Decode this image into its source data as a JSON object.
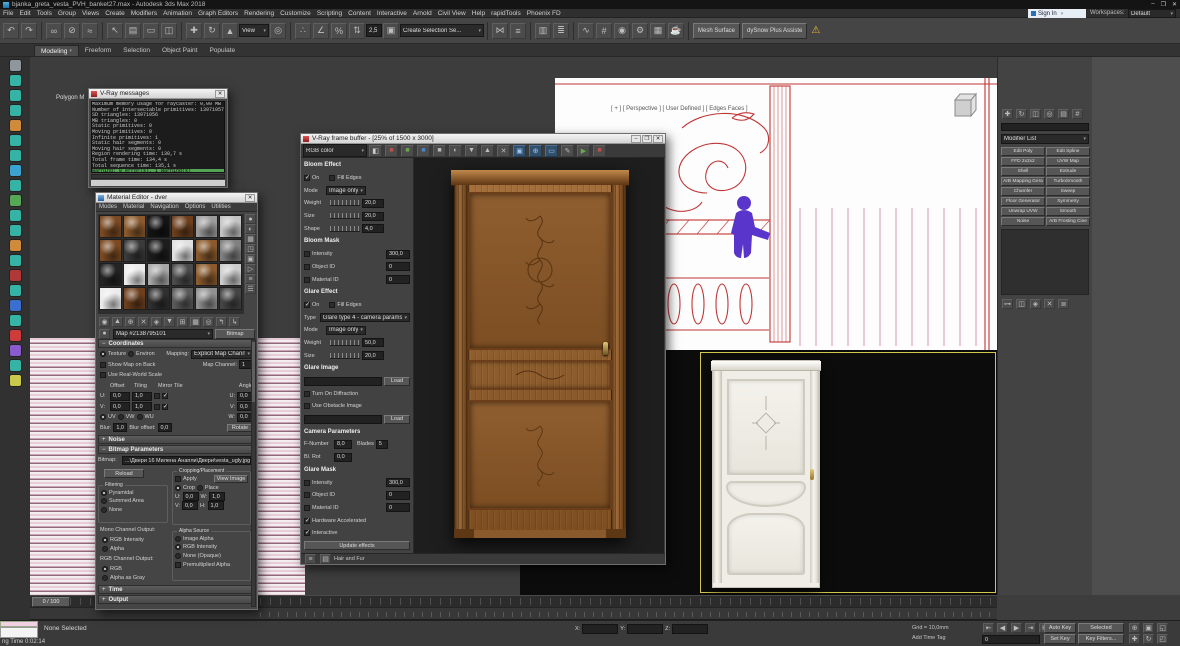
{
  "titlebar": {
    "title": "bjanka_greta_vesta_PVH_banket27.max - Autodesk 3ds Max 2018"
  },
  "window_buttons": {
    "minimize": "–",
    "maximize": "❐",
    "close": "✕"
  },
  "menus": [
    "File",
    "Edit",
    "Tools",
    "Group",
    "Views",
    "Create",
    "Modifiers",
    "Animation",
    "Graph Editors",
    "Rendering",
    "Customize",
    "Scripting",
    "Content",
    "Interactive",
    "Arnold",
    "Civil View",
    "Help",
    "rapidTools",
    "Phoenix FD"
  ],
  "topright": {
    "sign_in": "Sign In",
    "workspaces_label": "Workspaces:",
    "workspace_value": "Default"
  },
  "toolbar": {
    "items": [
      {
        "t": "i",
        "n": "undo-icon",
        "g": "↶"
      },
      {
        "t": "i",
        "n": "redo-icon",
        "g": "↷"
      },
      {
        "t": "s"
      },
      {
        "t": "i",
        "n": "select-and-link-icon",
        "g": "∞"
      },
      {
        "t": "i",
        "n": "unlink-selection-icon",
        "g": "⊘"
      },
      {
        "t": "i",
        "n": "bind-to-space-warp-icon",
        "g": "≈"
      },
      {
        "t": "s"
      },
      {
        "t": "i",
        "n": "select-object-icon",
        "g": "↖"
      },
      {
        "t": "i",
        "n": "select-by-name-icon",
        "g": "▤"
      },
      {
        "t": "i",
        "n": "rectangular-selection-region-icon",
        "g": "▭"
      },
      {
        "t": "i",
        "n": "window-crossing-icon",
        "g": "◫"
      },
      {
        "t": "s"
      },
      {
        "t": "i",
        "n": "select-and-move-icon",
        "g": "✚"
      },
      {
        "t": "i",
        "n": "select-and-rotate-icon",
        "g": "↻"
      },
      {
        "t": "i",
        "n": "select-and-scale-icon",
        "g": "▲"
      },
      {
        "t": "dd",
        "n": "reference-coordinate-dropdown",
        "v": "View",
        "w": 30
      },
      {
        "t": "i",
        "n": "use-pivot-point-icon",
        "g": "◎"
      },
      {
        "t": "s"
      },
      {
        "t": "i",
        "n": "snap-toggle-icon",
        "g": "∴"
      },
      {
        "t": "i",
        "n": "angle-snap-icon",
        "g": "∠"
      },
      {
        "t": "i",
        "n": "percent-snap-icon",
        "g": "%"
      },
      {
        "t": "i",
        "n": "spinner-snap-icon",
        "g": "⇅"
      },
      {
        "t": "f",
        "n": "snap-value-field",
        "v": "2,5",
        "w": 16
      },
      {
        "t": "i",
        "n": "edit-named-selection-sets-icon",
        "g": "▣"
      },
      {
        "t": "dd",
        "n": "named-selection-set-dropdown",
        "v": "Create Selection Se...",
        "w": 84
      },
      {
        "t": "s"
      },
      {
        "t": "i",
        "n": "mirror-icon",
        "g": "⋈"
      },
      {
        "t": "i",
        "n": "align-icon",
        "g": "≡"
      },
      {
        "t": "s"
      },
      {
        "t": "i",
        "n": "toggle-scene-explorer-icon",
        "g": "▥"
      },
      {
        "t": "i",
        "n": "toggle-layer-explorer-icon",
        "g": "≣"
      },
      {
        "t": "s"
      },
      {
        "t": "i",
        "n": "curve-editor-icon",
        "g": "∿"
      },
      {
        "t": "i",
        "n": "schematic-view-icon",
        "g": "#"
      },
      {
        "t": "i",
        "n": "material-editor-icon",
        "g": "◉"
      },
      {
        "t": "i",
        "n": "render-setup-icon",
        "g": "⚙"
      },
      {
        "t": "i",
        "n": "rendered-frame-window-icon",
        "g": "▦"
      },
      {
        "t": "i",
        "n": "render-production-icon",
        "g": "☕"
      },
      {
        "t": "s"
      },
      {
        "t": "lb",
        "n": "mesh-surface-button",
        "v": "Mesh Surface"
      },
      {
        "t": "lb",
        "n": "dysnow-plus-button",
        "v": "dySnow Plus Assiste"
      },
      {
        "t": "w",
        "n": "plugin-warning-icon",
        "g": "⚠"
      }
    ]
  },
  "ribbon_tabs": [
    "Modeling",
    "Freeform",
    "Selection",
    "Object Paint",
    "Populate"
  ],
  "left_toolbar": [
    "#8f969c",
    "#35b3a4",
    "#35b3a4",
    "#35b3a4",
    "#cf8a3a",
    "#35b3a4",
    "#35b3a4",
    "#3aa3cf",
    "#35b3a4",
    "#56a756",
    "#35b3a4",
    "#35b3a4",
    "#cf8a3a",
    "#35b3a4",
    "#b23737",
    "#35b3a4",
    "#3a6ecf",
    "#35b3a4",
    "#cf3a3a",
    "#8a5acf",
    "#35b3a4",
    "#c8c84a"
  ],
  "viewport": {
    "label": "[ + ] [ Perspective ] [ User Defined ] [ Edges Faces ]",
    "overlay": "Polygon M",
    "timeline_range": "0 / 100"
  },
  "vray_messages": {
    "title": "V-Ray messages",
    "lines": [
      "Maximum memory usage for raycaster: 0,00 MB",
      "Number of intersectable primitives: 13971057",
      "SD triangles: 13971056",
      "MB triangles: 0",
      "Static primitives: 0",
      "Moving primitives: 0",
      "Infinite primitives: 1",
      "Static hair segments: 0",
      "Moving hair segments: 0",
      "Region rendering time: 130,7 s",
      "Total frame time: 134,4 s",
      "Total sequence time: 135,1 s"
    ],
    "warning": "warning: 0 error(s), 1 warning(s)"
  },
  "material_editor": {
    "title": "Material Editor - dver",
    "menus": [
      "Modes",
      "Material",
      "Navigation",
      "Options",
      "Utilities"
    ],
    "swatches": [
      "#7b4a22",
      "#8a5a2c",
      "#141414",
      "#6d3f1d",
      "#9c9c9c",
      "#c2c2c2",
      "#7b4a22",
      "#3a3a3a",
      "#1d1d1d",
      "#e0e0e0",
      "#8a5a2c",
      "#808080",
      "#242424",
      "#ececec",
      "#a8a8a8",
      "#4c4c4c",
      "#8a5a2c",
      "#cccccc",
      "#ececec",
      "#6d3f1d",
      "#303030",
      "#5a5a5a",
      "#909090",
      "#454545"
    ],
    "side_icons": [
      {
        "n": "sample-type-icon",
        "g": "●"
      },
      {
        "n": "backlight-icon",
        "g": "◐"
      },
      {
        "n": "background-icon",
        "g": "▦"
      },
      {
        "n": "sample-uv-tiling-icon",
        "g": "◳"
      },
      {
        "n": "video-color-check-icon",
        "g": "▣"
      },
      {
        "n": "make-preview-icon",
        "g": "▷"
      },
      {
        "n": "options-icon",
        "g": "≡"
      },
      {
        "n": "select-by-material-icon",
        "g": "☰"
      }
    ],
    "toolbar_icons": [
      {
        "n": "get-material-icon",
        "g": "◉"
      },
      {
        "n": "put-material-to-scene-icon",
        "g": "▲"
      },
      {
        "n": "assign-material-to-selection-icon",
        "g": "⊕"
      },
      {
        "n": "reset-map-icon",
        "g": "✕"
      },
      {
        "n": "make-unique-icon",
        "g": "◈"
      },
      {
        "n": "put-to-library-icon",
        "g": "▼"
      },
      {
        "n": "material-id-channel-icon",
        "g": "⊞"
      },
      {
        "n": "show-map-in-viewport-icon",
        "g": "▦"
      },
      {
        "n": "show-end-result-icon",
        "g": "◎"
      },
      {
        "n": "go-to-parent-icon",
        "g": "↰"
      },
      {
        "n": "go-forward-sibling-icon",
        "g": "↳"
      }
    ],
    "name_dropdown": "Map #2138795101",
    "type_button": "Bitmap",
    "coordinates": {
      "header": "Coordinates",
      "texture": "Texture",
      "environ": "Environ",
      "mapping": "Mapping:",
      "mapping_value": "Explicit Map Channel",
      "show_map_on_back": "Show Map on Back",
      "map_channel": "Map Channel:",
      "map_channel_value": "1",
      "use_real_world": "Use Real-World Scale",
      "col_offset": "Offset",
      "col_tiling": "Tiling",
      "col_mirror": "Mirror",
      "col_tile": "Tile",
      "col_angle": "Angle",
      "u": "U:",
      "v": "V:",
      "w": "W:",
      "u_offset": "0,0",
      "u_tiling": "1,0",
      "v_offset": "0,0",
      "v_tiling": "1,0",
      "angle_u": "0,0",
      "angle_v": "0,0",
      "angle_w": "0,0",
      "uv": "UV",
      "vw": "VW",
      "wu": "WU",
      "blur": "Blur:",
      "blur_value": "1,0",
      "blur_offset": "Blur offset:",
      "blur_offset_value": "0,0",
      "rotate": "Rotate"
    },
    "noise_header": "Noise",
    "bp": {
      "header": "Bitmap Parameters",
      "bitmap_label": "Bitmap:",
      "path": "...\\Двери 16 Милена Анапли\\Двери\\vesta_ugly.jpg",
      "reload": "Reload",
      "cropping_group": "Cropping/Placement",
      "apply": "Apply",
      "view_image": "View Image",
      "crop": "Crop",
      "place": "Place",
      "u": "U:",
      "u_value": "0,0",
      "w": "W:",
      "w_value": "1,0",
      "v": "V:",
      "v_value": "0,0",
      "h": "H:",
      "h_value": "1,0",
      "filtering_group": "Filtering",
      "pyramidal": "Pyramidal",
      "summed_area": "Summed Area",
      "none": "None",
      "mono_label": "Mono Channel Output:",
      "rgb_intensity": "RGB Intensity",
      "alpha": "Alpha",
      "rgb_label": "RGB Channel Output:",
      "rgb": "RGB",
      "alpha_as_gray": "Alpha as Gray",
      "alpha_group": "Alpha Source",
      "image_alpha": "Image Alpha",
      "rgb_intensity2": "RGB Intensity",
      "none_opaque": "None (Opaque)",
      "premultiplied": "Premultiplied Alpha"
    },
    "time_header": "Time",
    "output_header": "Output"
  },
  "vfb": {
    "title": "V-Ray frame buffer - [25% of 1500 x 3000]",
    "channel": "RGB color",
    "toolbar_icons": [
      {
        "n": "show-rgb-icon",
        "g": "◧",
        "c": "#cccccc"
      },
      {
        "n": "red-channel-icon",
        "g": "■",
        "c": "#c0504d"
      },
      {
        "n": "green-channel-icon",
        "g": "■",
        "c": "#6aa84f"
      },
      {
        "n": "blue-channel-icon",
        "g": "■",
        "c": "#4a86c8"
      },
      {
        "n": "alpha-channel-icon",
        "g": "■",
        "c": "#bbbbbb"
      },
      {
        "n": "monochrome-icon",
        "g": "◐",
        "c": "#bbbbbb"
      },
      {
        "n": "save-image-icon",
        "g": "▼",
        "c": "#bbbbbb"
      },
      {
        "n": "load-image-icon",
        "g": "▲",
        "c": "#bbbbbb"
      },
      {
        "n": "clear-image-icon",
        "g": "✕",
        "c": "#bbbbbb"
      },
      {
        "n": "duplicate-to-host-icon",
        "g": "▣",
        "c": "#9fc4ea",
        "on": true
      },
      {
        "n": "track-mouse-icon",
        "g": "⊕",
        "c": "#9fc4ea",
        "on": true
      },
      {
        "n": "region-render-icon",
        "g": "▭",
        "c": "#9fc4ea",
        "on": true
      },
      {
        "n": "image-stamp-icon",
        "g": "✎",
        "c": "#bbbbbb"
      },
      {
        "n": "start-interactive-render-icon",
        "g": "▶",
        "c": "#6aa84f"
      },
      {
        "n": "stop-render-icon",
        "g": "■",
        "c": "#c0504d"
      }
    ],
    "rows": [
      {
        "t": "h",
        "x": "Bloom Effect"
      },
      {
        "t": "cc",
        "a": "On",
        "ao": 1,
        "b": "Fill Edges",
        "bo": 0
      },
      {
        "t": "dd",
        "l": "Mode",
        "v": "Image only"
      },
      {
        "t": "sl",
        "l": "Weight",
        "v": "20,0"
      },
      {
        "t": "sl",
        "l": "Size",
        "v": "20,0"
      },
      {
        "t": "sl",
        "l": "Shape",
        "v": "4,0"
      },
      {
        "t": "h2",
        "x": "Bloom Mask"
      },
      {
        "t": "cf",
        "l": "Intensity",
        "v": "300,0",
        "o": 0
      },
      {
        "t": "cf",
        "l": "Object ID",
        "v": "0",
        "o": 0
      },
      {
        "t": "cf",
        "l": "Material ID",
        "v": "0",
        "o": 0
      },
      {
        "t": "h",
        "x": "Glare Effect"
      },
      {
        "t": "cc",
        "a": "On",
        "ao": 1,
        "b": "Fill Edges",
        "bo": 0
      },
      {
        "t": "dd",
        "l": "Type",
        "v": "Glare type 4 - camera params"
      },
      {
        "t": "dd",
        "l": "Mode",
        "v": "Image only"
      },
      {
        "t": "sl",
        "l": "Weight",
        "v": "50,0"
      },
      {
        "t": "sl",
        "l": "Size",
        "v": "20,0"
      },
      {
        "t": "h2",
        "x": "Glare Image"
      },
      {
        "t": "ld",
        "btn": "Load"
      },
      {
        "t": "c1",
        "l": "Turn On Diffraction",
        "o": 0
      },
      {
        "t": "c1",
        "l": "Use Obstacle Image",
        "o": 0
      },
      {
        "t": "ld",
        "btn": "Load"
      },
      {
        "t": "h2",
        "x": "Camera Parameters"
      },
      {
        "t": "ff",
        "al": "F-Number",
        "av": "8,0",
        "bl": "Blades",
        "bv": "5"
      },
      {
        "t": "f1",
        "l": "Bl. Rot",
        "v": "0,0"
      },
      {
        "t": "h2",
        "x": "Glare Mask"
      },
      {
        "t": "cf",
        "l": "Intensity",
        "v": "300,0",
        "o": 0
      },
      {
        "t": "cf",
        "l": "Object ID",
        "v": "0",
        "o": 0
      },
      {
        "t": "cf",
        "l": "Material ID",
        "v": "0",
        "o": 0
      },
      {
        "t": "c1",
        "l": "Hardware Accelerated",
        "o": 1
      },
      {
        "t": "c1",
        "l": "Interactive",
        "o": 1
      },
      {
        "t": "btn",
        "l": "Update effects"
      }
    ],
    "status": "Hair and Fur"
  },
  "command_panel": {
    "tabs": [
      {
        "n": "create-tab-icon",
        "g": "✚"
      },
      {
        "n": "modify-tab-icon",
        "g": "↻"
      },
      {
        "n": "hierarchy-tab-icon",
        "g": "◫"
      },
      {
        "n": "motion-tab-icon",
        "g": "◎"
      },
      {
        "n": "display-tab-icon",
        "g": "▤"
      },
      {
        "n": "utilities-tab-icon",
        "g": "#"
      }
    ],
    "name_field": "",
    "modifier_list_label": "Modifier List",
    "modifiers": [
      "Edit Poly",
      "Edit Spline",
      "FFD 2x2x2",
      "UVW Map",
      "Shell",
      "Extrude",
      "ArB Mapping Gera",
      "TurboSmooth",
      "Chamfer",
      "Sweep",
      "Floor Generator",
      "Symmetry",
      "Unwrap UVW",
      "Smooth",
      "Noise",
      "ArB Frosting Cine"
    ],
    "stack_buttons": [
      {
        "n": "pin-stack-icon",
        "g": "⊶"
      },
      {
        "n": "show-end-result-icon",
        "g": "◫"
      },
      {
        "n": "make-unique-icon",
        "g": "◈"
      },
      {
        "n": "remove-modifier-icon",
        "g": "✕"
      },
      {
        "n": "configure-modifier-sets-icon",
        "g": "≣"
      }
    ]
  },
  "statusbar": {
    "selection": "None Selected",
    "prompt": "ng Time  0:02:14",
    "x_label": "X:",
    "y_label": "Y:",
    "z_label": "Z:",
    "x_value": "",
    "y_value": "",
    "z_value": "",
    "grid": "Grid = 10,0mm",
    "add_time_tag": "Add Time Tag",
    "auto_key": "Auto Key",
    "selected_mode": "Selected",
    "set_key": "Set Key",
    "key_filters": "Key Filters...",
    "time_value": "0",
    "transport": [
      {
        "n": "go-to-start-icon",
        "g": "⇤"
      },
      {
        "n": "previous-frame-icon",
        "g": "◀"
      },
      {
        "n": "play-animation-icon",
        "g": "▶"
      },
      {
        "n": "go-to-end-icon",
        "g": "⇥"
      },
      {
        "n": "key-mode-icon",
        "g": "K"
      }
    ],
    "nav": [
      {
        "n": "zoom-icon",
        "g": "⊕"
      },
      {
        "n": "zoom-extents-icon",
        "g": "▣"
      },
      {
        "n": "zoom-region-icon",
        "g": "◱"
      },
      {
        "n": "pan-icon",
        "g": "✚"
      },
      {
        "n": "orbit-icon",
        "g": "↻"
      },
      {
        "n": "maximize-viewport-toggle-icon",
        "g": "◰"
      }
    ]
  }
}
